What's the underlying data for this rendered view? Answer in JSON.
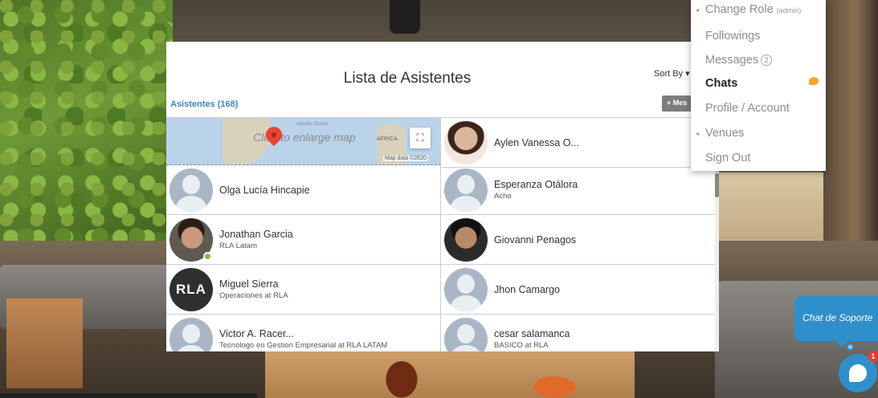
{
  "modal": {
    "title": "Lista de Asistentes",
    "sort_label": "Sort By ▾",
    "count_label": "Asistentes (168)",
    "message_button": "+ Mes"
  },
  "map": {
    "overlay_text": "Click to enlarge map",
    "africa_label": "AFRICA",
    "atlantic_label": "Atlantic Ocean",
    "attribution": "Map data ©2020"
  },
  "attendees": [
    {
      "name": "Aylen Vanessa O...",
      "subtitle": "",
      "avatar": "photo-woman"
    },
    {
      "name": "Olga Lucía Hincapie",
      "subtitle": "",
      "avatar": "placeholder"
    },
    {
      "name": "Esperanza Otálora",
      "subtitle": "Acho",
      "avatar": "placeholder"
    },
    {
      "name": "Jonathan Garcia",
      "subtitle": "RLA Latam",
      "avatar": "photo-man1",
      "online": true
    },
    {
      "name": "Giovanni Penagos",
      "subtitle": "",
      "avatar": "photo-man2"
    },
    {
      "name": "Miguel Sierra",
      "subtitle": "Operaciones at RLA",
      "avatar": "logo",
      "logo_text": "RLA"
    },
    {
      "name": "Jhon Camargo",
      "subtitle": "",
      "avatar": "placeholder"
    },
    {
      "name": "Victor A. Racer...",
      "subtitle": "Tecnologo en Gestion Empresarial at RLA LATAM",
      "avatar": "placeholder"
    },
    {
      "name": "cesar salamanca",
      "subtitle": "BASICO at RLA",
      "avatar": "placeholder"
    }
  ],
  "menu": {
    "change_role": "Change Role",
    "role_tag": "(admin)",
    "followings": "Followings",
    "messages": "Messages",
    "messages_count": "2",
    "chats": "Chats",
    "profile": "Profile / Account",
    "venues": "Venues",
    "sign_out": "Sign Out"
  },
  "support": {
    "bubble_text": "Chat de Soporte",
    "badge_count": "1"
  },
  "colors": {
    "link_blue": "#3d86c6",
    "support_blue": "#2f8fcb",
    "chat_dot": "#f5a623",
    "online_green": "#7bc043"
  }
}
